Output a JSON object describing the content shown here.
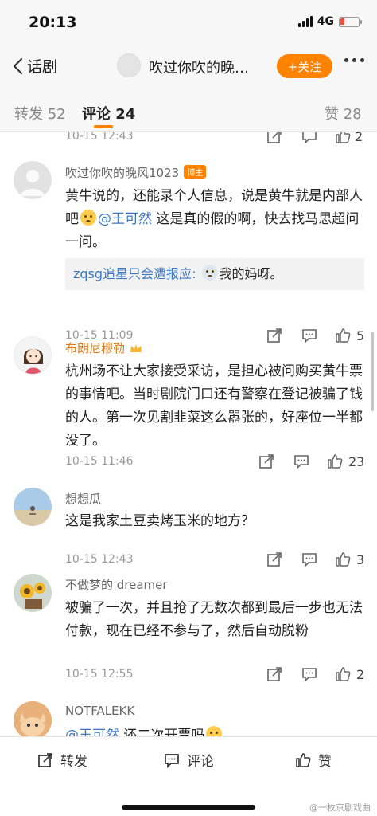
{
  "status_bar": {
    "time": "20:13",
    "network": "4G"
  },
  "nav": {
    "back_label": "话剧",
    "title": "吹过你吹的晚…",
    "follow_label": "+关注"
  },
  "tabs": [
    {
      "label": "转发",
      "count": "52"
    },
    {
      "label": "评论",
      "count": "24"
    },
    {
      "label": "赞",
      "count": "28"
    }
  ],
  "partial_top": {
    "time": "10-15 12:43",
    "like_count": "2"
  },
  "comments": [
    {
      "user": "吹过你吹的晚风1023",
      "badge": "博主",
      "text_a": "黄牛说的，还能录个人信息，说是黄牛就是内部人吧",
      "mention": "@王可然",
      "text_b": " 这是真的假的啊，快去找马思超问一问。",
      "reply_user": "zqsg追星只会遭报应",
      "reply_text": "我的妈呀。",
      "time": "10-15 11:09",
      "likes": "5"
    },
    {
      "user": "布朗尼穆勒",
      "text": "杭州场不让大家接受采访，是担心被问购买黄牛票的事情吧。当时剧院门口还有警察在登记被骗了钱的人。第一次见割韭菜这么嚣张的，好座位一半都没了。",
      "time": "10-15 11:46",
      "likes": "23"
    },
    {
      "user": "想想瓜",
      "text": "这是我家土豆卖烤玉米的地方？",
      "time": "10-15 12:43",
      "likes": "3"
    },
    {
      "user": "不做梦的 dreamer",
      "text": "被骗了一次，并且抢了无数次都到最后一步也无法付款，现在已经不参与了，然后自动脱粉",
      "time": "10-15 12:55",
      "likes": "2"
    },
    {
      "user": "NOTFALEKK",
      "mention": "@王可然",
      "text_b": " 还二次开票吗"
    }
  ],
  "bottom_bar": {
    "repost_label": "转发",
    "comment_label": "评论",
    "like_label": "赞"
  },
  "watermark": "@一枚京剧戏曲",
  "colors": {
    "accent": "#ff8200",
    "link": "#3e78c4",
    "muted": "#999999"
  },
  "icons": [
    "chevron-left-icon",
    "more-dots-icon",
    "repost-icon",
    "comment-icon",
    "thumbs-up-icon",
    "crown-icon",
    "emoji-icon"
  ]
}
